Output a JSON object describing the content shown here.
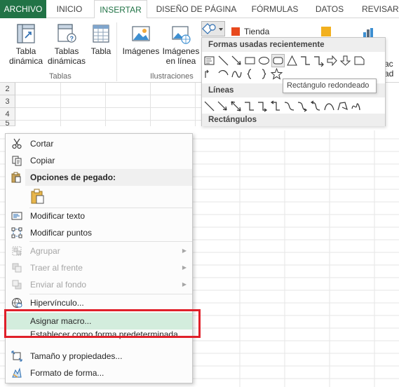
{
  "tabs": {
    "archivo": "ARCHIVO",
    "inicio": "INICIO",
    "insertar": "INSERTAR",
    "diseno": "DISEÑO DE PÁGINA",
    "formulas": "FÓRMULAS",
    "datos": "DATOS",
    "revisar": "REVISAR"
  },
  "ribbon": {
    "tabla_dinamica": [
      "Tabla",
      "dinámica"
    ],
    "tablas_dinamicas": [
      "Tablas",
      "dinámicas"
    ],
    "tabla": "Tabla",
    "imagenes": "Imágenes",
    "imagenes_linea": [
      "Imágenes",
      "en línea"
    ],
    "group_tablas": "Tablas",
    "group_ilustraciones": "Ilustraciones",
    "tienda": "Tienda",
    "partial_right_1": "ac",
    "partial_right_2": "ad"
  },
  "rows": [
    "2",
    "3",
    "4",
    "5"
  ],
  "gallery": {
    "recent_header": "Formas usadas recientemente",
    "lines_header": "Líneas",
    "rect_header": "Rectángulos",
    "tooltip": "Rectángulo redondeado"
  },
  "menu": {
    "cortar": "Cortar",
    "copiar": "Copiar",
    "opciones_pegado": "Opciones de pegado:",
    "modificar_texto": "Modificar texto",
    "modificar_puntos": "Modificar puntos",
    "agrupar": "Agrupar",
    "traer_frente": "Traer al frente",
    "enviar_fondo": "Enviar al fondo",
    "hipervinculo": "Hipervínculo...",
    "asignar_macro": "Asignar macro...",
    "establecer_forma": "Establecer como forma predeterminada",
    "tamano": "Tamaño y propiedades...",
    "formato_forma": "Formato de forma..."
  },
  "colors": {
    "excel_green": "#217346",
    "highlight": "#d3eddd",
    "red_annotation": "#e0202a"
  }
}
